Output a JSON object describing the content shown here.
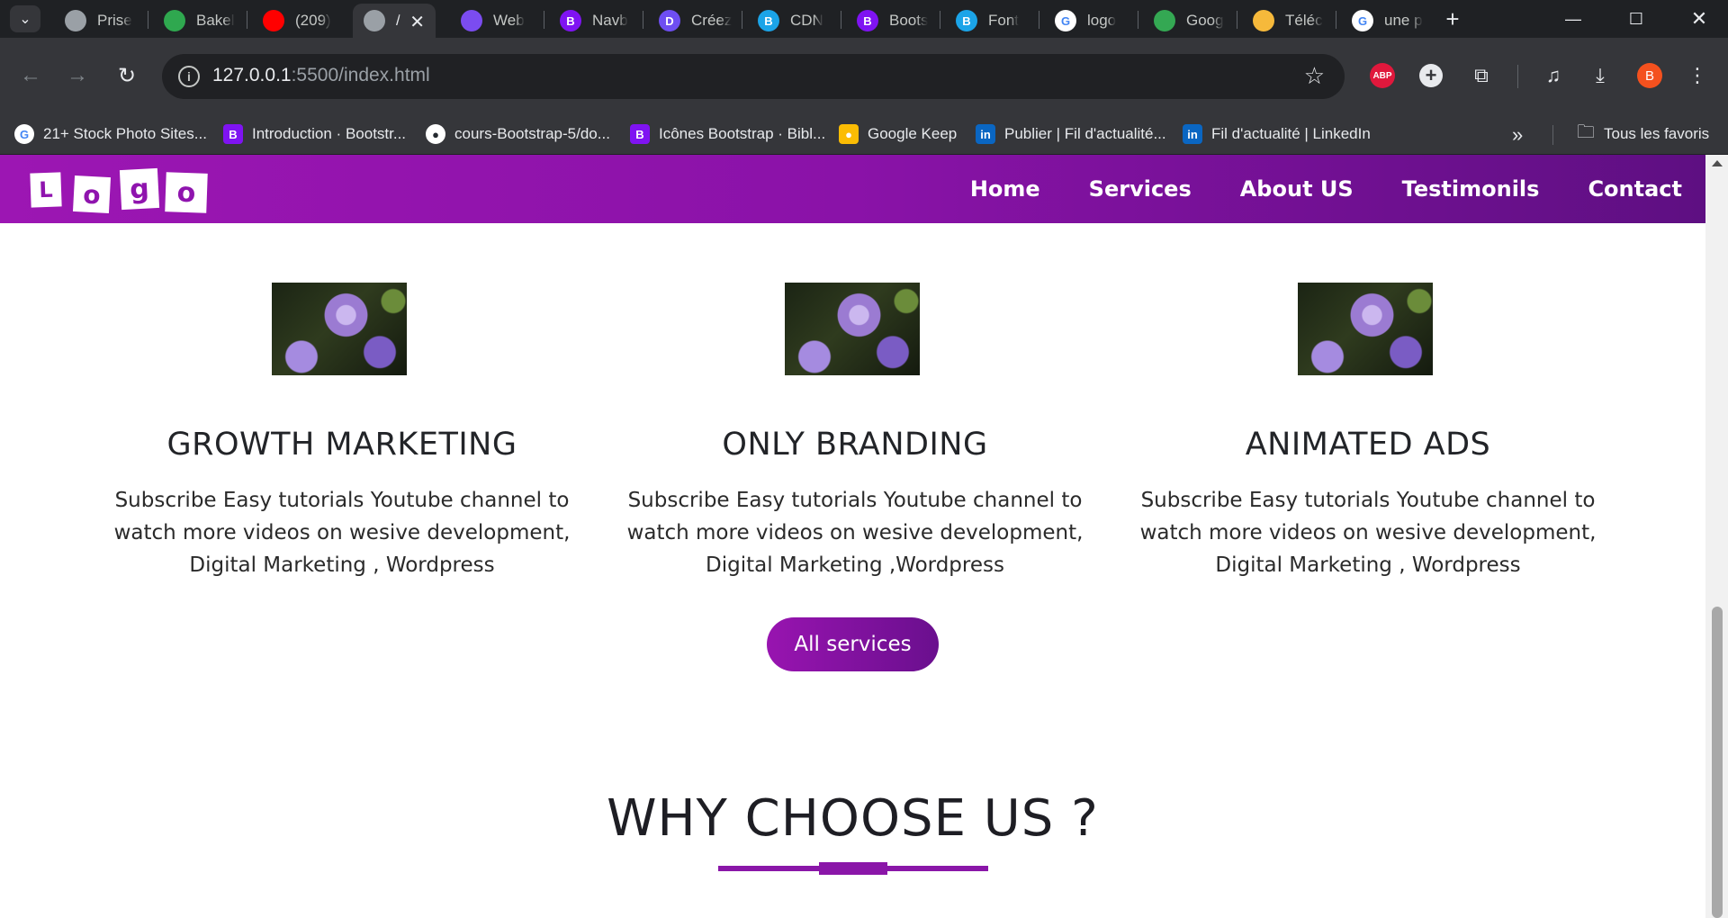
{
  "browser": {
    "tabs": [
      {
        "title": "Prise",
        "icon": "globe-icon",
        "color": "#9aa0a6"
      },
      {
        "title": "Bakel",
        "icon": "bakeli-icon",
        "color": "#2fa84f"
      },
      {
        "title": "(209)",
        "icon": "youtube-icon",
        "color": "#ff0000"
      },
      {
        "title": "/",
        "icon": "globe-icon",
        "color": "#9aa0a6",
        "active": true
      },
      {
        "title": "Web",
        "icon": "h-icon",
        "color": "#7b4cf0"
      },
      {
        "title": "Navb",
        "icon": "bootstrap-icon",
        "color": "#7f13f2",
        "badge": "B"
      },
      {
        "title": "Créez",
        "icon": "d-icon",
        "color": "#6e4ef2",
        "badge": "D"
      },
      {
        "title": "CDN",
        "icon": "bootstrap-icon",
        "color": "#1ba4e8",
        "badge": "B"
      },
      {
        "title": "Boots",
        "icon": "bootstrap-icon",
        "color": "#7f13f2",
        "badge": "B"
      },
      {
        "title": "Font",
        "icon": "bootstrap-icon",
        "color": "#1ba4e8",
        "badge": "B"
      },
      {
        "title": "logo",
        "icon": "google-icon",
        "color": "#ffffff",
        "badge": "G"
      },
      {
        "title": "Goog",
        "icon": "google-meet-icon",
        "color": "#34a853"
      },
      {
        "title": "Téléc",
        "icon": "download-site-icon",
        "color": "#f6b93b"
      },
      {
        "title": "une p",
        "icon": "google-icon",
        "color": "#ffffff",
        "badge": "G"
      }
    ],
    "url_host": "127.0.0.1",
    "url_path": ":5500/index.html",
    "bookmarks": [
      {
        "label": "21+ Stock Photo Sites...",
        "icon": "google-icon",
        "color": "#ffffff",
        "badge": "G"
      },
      {
        "label": "Introduction · Bootstr...",
        "icon": "bootstrap-icon",
        "color": "#7f13f2",
        "badge": "B"
      },
      {
        "label": "cours-Bootstrap-5/do...",
        "icon": "github-icon",
        "color": "#ffffff",
        "badge": "●"
      },
      {
        "label": "Icônes Bootstrap · Bibl...",
        "icon": "bootstrap-icon",
        "color": "#7f13f2",
        "badge": "B"
      },
      {
        "label": "Google Keep",
        "icon": "keep-icon",
        "color": "#fbbc04",
        "badge": "●"
      },
      {
        "label": "Publier | Fil d'actualité...",
        "icon": "linkedin-icon",
        "color": "#0a66c2",
        "badge": "in"
      },
      {
        "label": "Fil d'actualité | LinkedIn",
        "icon": "linkedin-icon",
        "color": "#0a66c2",
        "badge": "in"
      }
    ],
    "all_bookmarks_label": "Tous les favoris",
    "profile_initial": "B",
    "abp_label": "ABP"
  },
  "site": {
    "logo_letters": [
      "L",
      "o",
      "g",
      "o"
    ],
    "nav": [
      "Home",
      "Services",
      "About US",
      "Testimonils",
      "Contact"
    ],
    "services": [
      {
        "title": "GROWTH MARKETING",
        "desc": "Subscribe Easy tutorials Youtube channel to watch more videos on wesive development, Digital Marketing , Wordpress"
      },
      {
        "title": "ONLY BRANDING",
        "desc": "Subscribe Easy tutorials Youtube channel to watch more videos on wesive development, Digital Marketing ,Wordpress"
      },
      {
        "title": "ANIMATED ADS",
        "desc": "Subscribe Easy tutorials Youtube channel to watch more videos on wesive development, Digital Marketing , Wordpress"
      }
    ],
    "all_services_label": "All services",
    "why_title": "WHY CHOOSE US ?"
  },
  "colors": {
    "brand_purple": "#8a12a8",
    "brand_dark_purple": "#5e0f82"
  }
}
